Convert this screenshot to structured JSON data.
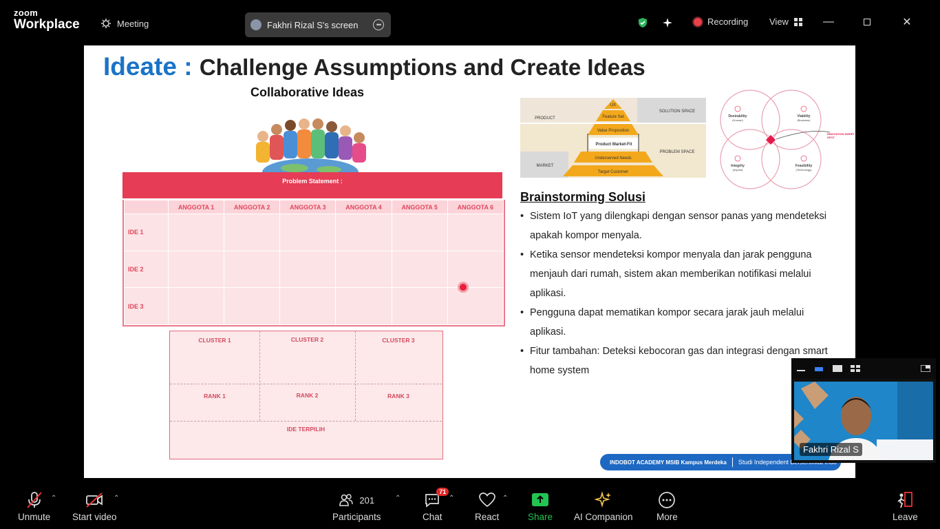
{
  "app": {
    "logo_line1": "zoom",
    "logo_line2": "Workplace",
    "meeting_label": "Meeting",
    "screen_share_label": "Fakhri Rizal S's screen",
    "recording_label": "Recording",
    "view_label": "View"
  },
  "slide": {
    "title_part1": "Ideate :",
    "title_part2": "Challenge Assumptions and Create Ideas",
    "collab_title": "Collaborative Ideas",
    "problem_statement": "Problem Statement :",
    "columns": [
      "ANGGOTA 1",
      "ANGGOTA 2",
      "ANGGOTA 3",
      "ANGGOTA 4",
      "ANGGOTA 5",
      "ANGGOTA 6"
    ],
    "rows": [
      "IDE 1",
      "IDE 2",
      "IDE 3"
    ],
    "cluster_labels": [
      "CLUSTER 1",
      "CLUSTER 2",
      "CLUSTER 3"
    ],
    "rank_labels": [
      "RANK 1",
      "RANK 2",
      "RANK 3"
    ],
    "ide_terpilih": "IDE TERPILIH",
    "pyramid": {
      "left_labels": [
        "PRODUCT",
        "MARKET"
      ],
      "right_labels": [
        "SOLUTION SPACE",
        "PROBLEM SPACE"
      ],
      "levels": [
        "UX",
        "Feature Set",
        "Value Proposition",
        "Product Market-Fit",
        "Underserved Needs",
        "Target Customer"
      ]
    },
    "venn": {
      "desirability": "Desirability",
      "desirability_sub": "(Human)",
      "viability": "Viability",
      "viability_sub": "(Business)",
      "integrity": "Integrity",
      "integrity_sub": "(Impact)",
      "feasibility": "Feasibility",
      "feasibility_sub": "(Technology)",
      "sweet_spot": "INNOVATION SWEET SPOT"
    },
    "brainstorm_title": "Brainstorming Solusi",
    "bullets": [
      "Sistem IoT yang dilengkapi dengan sensor panas yang mendeteksi apakah kompor menyala.",
      "Ketika sensor mendeteksi kompor menyala dan jarak pengguna menjauh dari rumah, sistem akan memberikan notifikasi melalui aplikasi.",
      "Pengguna dapat mematikan kompor secara jarak jauh melalui aplikasi.",
      "Fitur tambahan: Deteksi kebocoran gas dan integrasi dengan smart home system"
    ],
    "footer_logos": "INDOBOT ACADEMY  MSIB  Kampus Merdeka",
    "footer_text": "Studi Independent Bersertifikat Indo"
  },
  "video": {
    "participant_name": "Fakhri Rizal S"
  },
  "toolbar": {
    "unmute": "Unmute",
    "start_video": "Start video",
    "participants": "Participants",
    "participants_count": "201",
    "chat": "Chat",
    "chat_badge": "71",
    "react": "React",
    "share": "Share",
    "ai_companion": "AI Companion",
    "more": "More",
    "leave": "Leave"
  },
  "colors": {
    "share_green": "#23c552",
    "accent_blue": "#1a73c8",
    "table_red": "#e63c55"
  }
}
